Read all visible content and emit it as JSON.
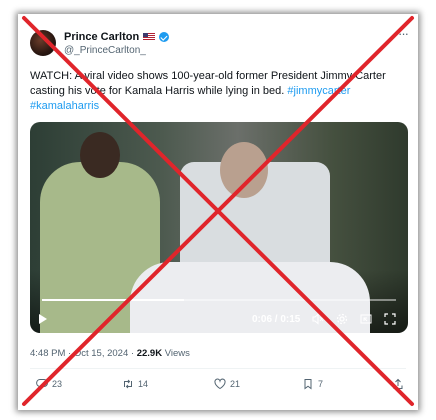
{
  "tweet": {
    "display_name": "Prince Carlton",
    "flag": "🇺🇸",
    "handle": "@_PrinceCarlton_",
    "more": "···",
    "text_plain": "WATCH: A viral video shows 100-year-old former President Jimmy Carter casting his vote for Kamala Harris while lying in bed.",
    "hashtags": [
      "#jimmycarter",
      "#kamalaharris"
    ],
    "video": {
      "time": "0:06 / 0:15",
      "progress": 0.4
    },
    "meta": {
      "time": "4:48 PM",
      "date": "Oct 15, 2024",
      "views_count": "22.9K",
      "views_label": "Views"
    },
    "actions": {
      "replies": "23",
      "retweets": "14",
      "likes": "21",
      "bookmarks": "7"
    }
  },
  "colors": {
    "accent": "#1d9bf0",
    "cross": "#e0252b",
    "text": "#0f1419",
    "secondary": "#536471"
  },
  "icons": [
    "verified-icon",
    "more-icon",
    "play-icon",
    "volume-icon",
    "settings-icon",
    "pip-icon",
    "fullscreen-icon",
    "reply-icon",
    "retweet-icon",
    "like-icon",
    "bookmark-icon",
    "share-icon"
  ]
}
